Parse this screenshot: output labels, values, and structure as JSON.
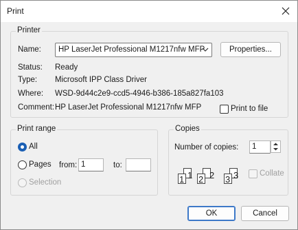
{
  "window": {
    "title": "Print"
  },
  "printer": {
    "group_title": "Printer",
    "name_label": "Name:",
    "name_value": "HP LaserJet Professional M1217nfw MFP",
    "properties_button": "Properties...",
    "status_label": "Status:",
    "status_value": "Ready",
    "type_label": "Type:",
    "type_value": "Microsoft IPP Class Driver",
    "where_label": "Where:",
    "where_value": "WSD-9d44c2e9-ccd5-4946-b386-185a827fa103",
    "comment_label": "Comment:",
    "comment_value": "HP LaserJet Professional M1217nfw MFP",
    "print_to_file_label": "Print to file",
    "print_to_file_checked": false
  },
  "print_range": {
    "group_title": "Print range",
    "all_label": "All",
    "pages_label": "Pages",
    "from_label": "from:",
    "from_value": "1",
    "to_label": "to:",
    "to_value": "",
    "selection_label": "Selection",
    "selected": "All"
  },
  "copies": {
    "group_title": "Copies",
    "number_label": "Number of copies:",
    "number_value": "1",
    "collate_label": "Collate",
    "collate_checked": false,
    "collate_pages": [
      "1",
      "1",
      "2",
      "2",
      "3",
      "3"
    ]
  },
  "buttons": {
    "ok": "OK",
    "cancel": "Cancel"
  },
  "colors": {
    "accent": "#3c78c8",
    "radio_checked": "#1a5fb4"
  }
}
